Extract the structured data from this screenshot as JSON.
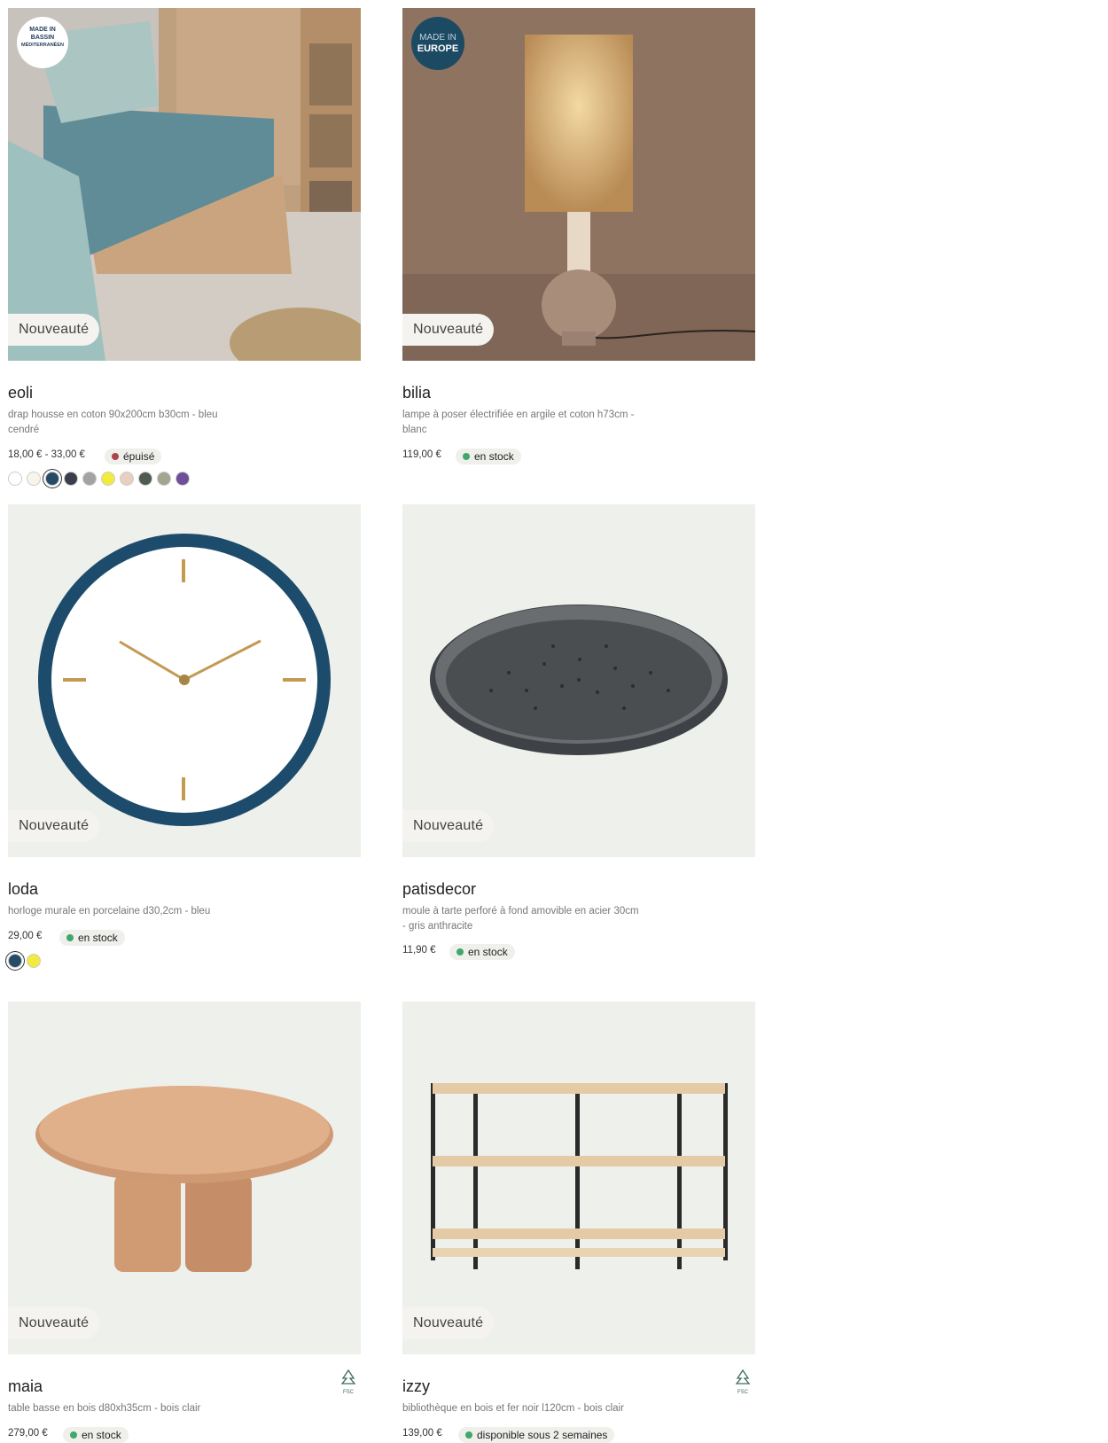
{
  "badge_label": "Nouveauté",
  "products": [
    {
      "name": "eoli",
      "description": "drap housse en coton 90x200cm b30cm - bleu cendré",
      "price": "18,00 € - 33,00 €",
      "stock": {
        "label": "épuisé",
        "color": "#b0424a"
      },
      "badge_logo": {
        "line1": "MADE IN",
        "line2": "BASSIN",
        "line3": "MÉDITERRANÉEN"
      },
      "swatches": [
        "#ffffff",
        "#f7f5ea",
        "#274b66",
        "#3b3f4c",
        "#a3a3a3",
        "#f2ea3e",
        "#e8cfc2",
        "#505a52",
        "#a3a58f",
        "#6e4f9a"
      ],
      "selected_swatch": 2
    },
    {
      "name": "bilia",
      "description": "lampe à poser électrifiée en argile et coton h73cm - blanc",
      "price": "119,00 €",
      "stock": {
        "label": "en stock",
        "color": "#3fa86a"
      },
      "badge_logo": {
        "line1": "MADE IN",
        "line2": "EUROPE"
      }
    },
    {
      "name": "loda",
      "description": "horloge murale en porcelaine d30,2cm - bleu",
      "price": "29,00 €",
      "stock": {
        "label": "en stock",
        "color": "#3fa86a"
      },
      "swatches": [
        "#274b66",
        "#f2ea3e"
      ],
      "selected_swatch": 0
    },
    {
      "name": "patisdecor",
      "description": "moule à tarte perforé à fond amovible en acier 30cm - gris anthracite",
      "price": "11,90 €",
      "stock": {
        "label": "en stock",
        "color": "#3fa86a"
      }
    },
    {
      "name": "maia",
      "description": "table basse en bois d80xh35cm - bois clair",
      "price": "279,00 €",
      "stock": {
        "label": "en stock",
        "color": "#3fa86a"
      },
      "eco_label": "FSC"
    },
    {
      "name": "izzy",
      "description": "bibliothèque en bois et fer noir l120cm - bois clair",
      "price": "139,00 €",
      "stock": {
        "label": "disponible sous 2 semaines",
        "color": "#3fa86a"
      },
      "eco_label": "FSC"
    }
  ]
}
